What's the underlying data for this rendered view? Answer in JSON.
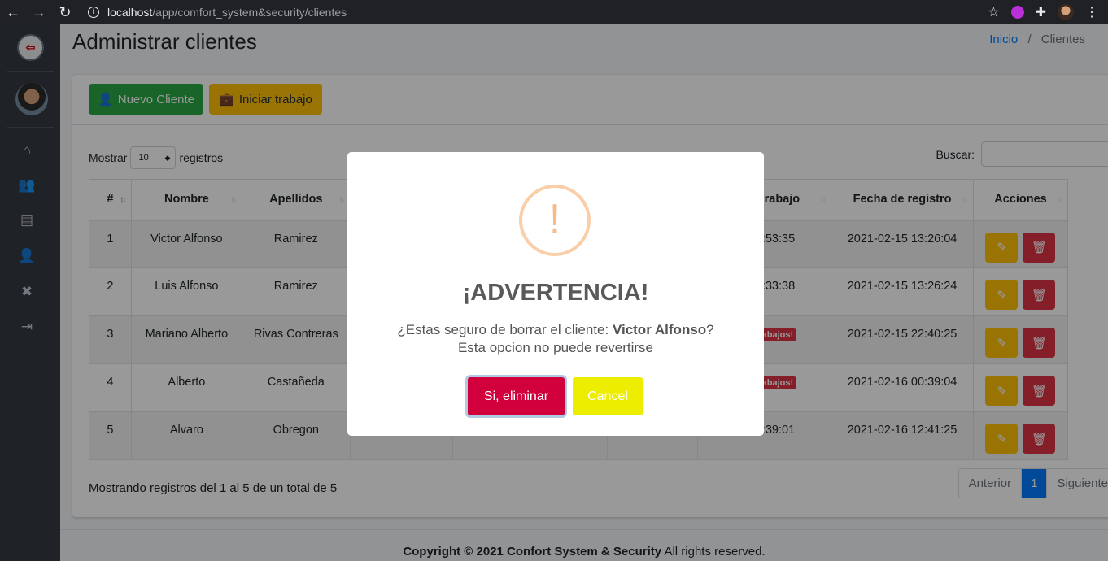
{
  "browser": {
    "url_host": "localhost",
    "url_path": "/app/comfort_system&security/clientes"
  },
  "header": {
    "title": "Administrar clientes",
    "breadcrumb_home": "Inicio",
    "breadcrumb_sep": "/",
    "breadcrumb_current": "Clientes"
  },
  "toolbar": {
    "new_client_label": "Nuevo Cliente",
    "start_work_label": "Iniciar trabajo"
  },
  "table_controls": {
    "show_label": "Mostrar",
    "show_value": "10",
    "records_label": "registros",
    "search_label": "Buscar:"
  },
  "table": {
    "columns": [
      "#",
      "Nombre",
      "Apellidos",
      "",
      "",
      "",
      "rabajo",
      "Fecha de registro",
      "Acciones"
    ],
    "rows": [
      {
        "num": "1",
        "nombre": "Victor Alfonso",
        "apellidos": "Ramirez",
        "trabajo": "2 18:53:35",
        "fecha": "2021-02-15 13:26:04"
      },
      {
        "num": "2",
        "nombre": "Luis Alfonso",
        "apellidos": "Ramirez",
        "trabajo": "2 18:33:38",
        "fecha": "2021-02-15 13:26:24"
      },
      {
        "num": "3",
        "nombre": "Mariano Alberto",
        "apellidos": "Rivas Contreras",
        "trabajo": "abajos!",
        "fecha": "2021-02-15 22:40:25"
      },
      {
        "num": "4",
        "nombre": "Alberto",
        "apellidos": "Castañeda",
        "trabajo": "abajos!",
        "fecha": "2021-02-16 00:39:04"
      },
      {
        "num": "5",
        "nombre": "Alvaro",
        "apellidos": "Obregon",
        "trabajo": "2 19:39:01",
        "fecha": "2021-02-16 12:41:25"
      }
    ]
  },
  "pagination": {
    "info": "Mostrando registros del 1 al 5 de un total de 5",
    "prev": "Anterior",
    "page": "1",
    "next": "Siguiente"
  },
  "footer": {
    "copyright": "Copyright © 2021 Confort System & Security",
    "rights": " All rights reserved."
  },
  "modal": {
    "icon": "!",
    "title": "¡ADVERTENCIA!",
    "text_prefix": "¿Estas seguro de borrar el cliente: ",
    "client_name": "Victor Alfonso",
    "text_suffix": "?",
    "text_line2": "Esta opcion no puede revertirse",
    "confirm_label": "Si, eliminar",
    "cancel_label": "Cancel"
  },
  "colors": {
    "sidebar": "#343a40",
    "success": "#28a745",
    "warning": "#ffc107",
    "danger": "#dc3545",
    "primary": "#007bff",
    "confirm": "#d1003c",
    "cancel": "#eded00"
  }
}
